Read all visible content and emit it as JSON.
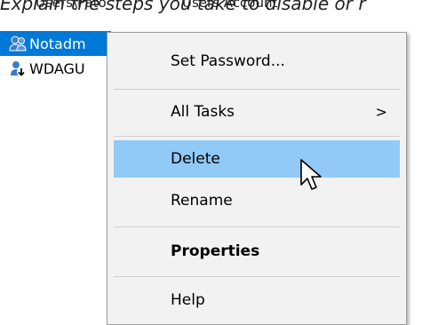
{
  "instruction": "Explain the steps you take to disable or r",
  "background_columns": [
    "Users\\Pato",
    "Users Account"
  ],
  "tree": [
    {
      "label": "Notadm",
      "selected": true,
      "icon": "user-icon"
    },
    {
      "label": "WDAGU",
      "selected": false,
      "icon": "user-disabled-icon"
    }
  ],
  "context_menu": {
    "items": [
      {
        "label": "Set Password...",
        "bold": false,
        "has_submenu": false,
        "highlighted": false
      },
      {
        "label": "All Tasks",
        "bold": false,
        "has_submenu": true,
        "highlighted": false,
        "submenu_glyph": ">"
      },
      {
        "label": "Delete",
        "bold": false,
        "has_submenu": false,
        "highlighted": true
      },
      {
        "label": "Rename",
        "bold": false,
        "has_submenu": false,
        "highlighted": false
      },
      {
        "label": "Properties",
        "bold": true,
        "has_submenu": false,
        "highlighted": false
      },
      {
        "label": "Help",
        "bold": false,
        "has_submenu": false,
        "highlighted": false
      }
    ]
  },
  "colors": {
    "selection": "#0078d7",
    "menu_hover": "#91c9f7",
    "menu_bg": "#f2f2f2"
  }
}
